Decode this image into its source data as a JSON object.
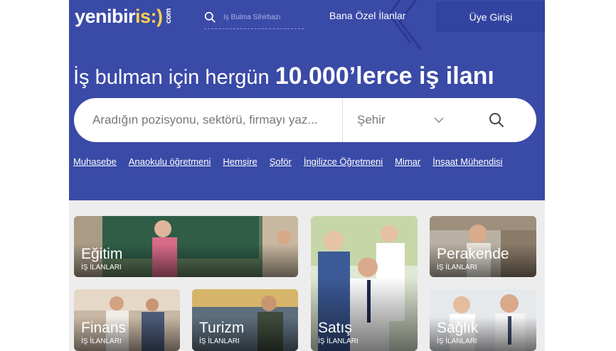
{
  "header": {
    "logo_main": "yenibir",
    "logo_accent": "is:)",
    "logo_suffix": "com",
    "search_placeholder": "İş Bulma Sihirbazı",
    "nav_link": "Bana Özel İlanlar",
    "login_label": "Üye Girişi"
  },
  "hero": {
    "headline_prefix": "İş bulman için hergün",
    "headline_highlight": "10.000’lerce iş ilanı",
    "search_placeholder": "Aradığın pozisyonu, sektörü, firmayı yaz...",
    "city_label": "Şehir",
    "quick_links": [
      "Muhasebe",
      "Anaokulu öğretmeni",
      "Hemşire",
      "Şoför",
      "İngilizce Öğretmeni",
      "Mimar",
      "İnşaat Mühendisi"
    ]
  },
  "categories": [
    {
      "title": "Eğitim",
      "sub": "İŞ İLANLARI"
    },
    {
      "title": "Satış",
      "sub": "İŞ İLANLARI"
    },
    {
      "title": "Perakende",
      "sub": "İŞ İLANLARI"
    },
    {
      "title": "Finans",
      "sub": "İŞ İLANLARI"
    },
    {
      "title": "Turizm",
      "sub": "İŞ İLANLARI"
    },
    {
      "title": "Sağlık",
      "sub": "İŞ İLANLARI"
    }
  ],
  "colors": {
    "brand": "#3a4aa7",
    "accent": "#ffd24a"
  }
}
